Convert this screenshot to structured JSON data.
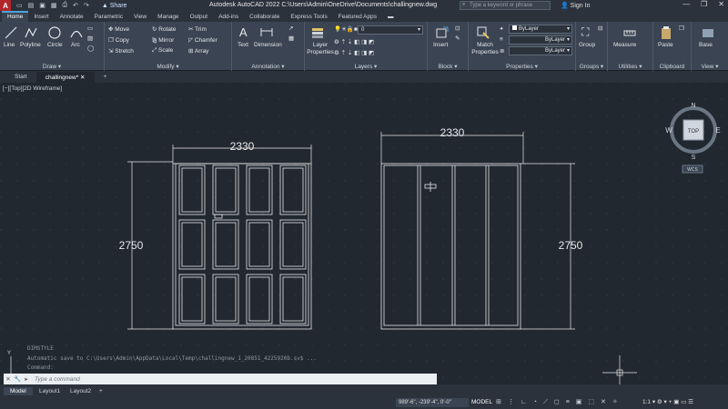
{
  "titlebar": {
    "app_logo": "A",
    "share_label": "Share",
    "title": "Autodesk AutoCAD 2022    C:\\Users\\Admin\\OneDrive\\Documents\\challingnew.dwg",
    "search_placeholder": "Type a keyword or phrase",
    "signin_label": "Sign In"
  },
  "ribbon_tabs": [
    "Home",
    "Insert",
    "Annotate",
    "Parametric",
    "View",
    "Manage",
    "Output",
    "Add-ins",
    "Collaborate",
    "Express Tools",
    "Featured Apps"
  ],
  "ribbon": {
    "draw": {
      "title": "Draw",
      "line": "Line",
      "polyline": "Polyline",
      "circle": "Circle",
      "arc": "Arc"
    },
    "modify": {
      "title": "Modify",
      "move": "Move",
      "rotate": "Rotate",
      "trim": "Trim",
      "copy": "Copy",
      "mirror": "Mirror",
      "chamfer": "Chamfer",
      "stretch": "Stretch",
      "scale": "Scale",
      "array": "Array"
    },
    "annotation": {
      "title": "Annotation",
      "text": "Text",
      "dimension": "Dimension"
    },
    "layers": {
      "title": "Layers",
      "layer_properties": "Layer Properties",
      "current_layer": "0"
    },
    "block": {
      "title": "Block",
      "insert": "Insert"
    },
    "properties": {
      "title": "Properties",
      "match_properties": "Match Properties",
      "color": "ByLayer",
      "linetype": "ByLayer",
      "lineweight": "ByLayer"
    },
    "groups": {
      "title": "Groups",
      "group": "Group"
    },
    "utilities": {
      "title": "Utilities",
      "measure": "Measure"
    },
    "clipboard": {
      "title": "Clipboard",
      "paste": "Paste"
    },
    "view": {
      "title": "View",
      "base": "Base"
    }
  },
  "file_tabs": [
    "Start",
    "challingnew*"
  ],
  "viewport_label": "[−][Top][2D Wireframe]",
  "drawing": {
    "left_width": "2330",
    "left_height": "2750",
    "right_width": "2330",
    "right_height": "2750"
  },
  "viewcube": {
    "top": "TOP",
    "n": "N",
    "s": "S",
    "e": "E",
    "w": "W",
    "wcs": "WCS"
  },
  "command": {
    "history_1": "DIMSTYLE",
    "history_2": "Automatic save to C:\\Users\\Admin\\AppData\\Local\\Temp\\challingnew_1_20851_4225920b.sv$ ...",
    "history_3": "Command:",
    "placeholder": "Type a command"
  },
  "layout_tabs": [
    "Model",
    "Layout1",
    "Layout2"
  ],
  "status": {
    "coords": "989'-6\", -239'-4\", 0'-0\"",
    "model": "MODEL",
    "scale": "1:1"
  }
}
